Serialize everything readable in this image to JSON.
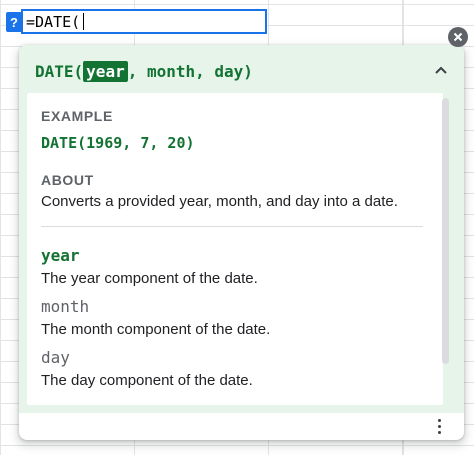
{
  "formula_bar": {
    "help_label": "?",
    "input_text": "=DATE("
  },
  "tooltip": {
    "signature": {
      "function_name": "DATE(",
      "active_arg": "year",
      "rest": ", month, day)"
    },
    "example": {
      "label": "EXAMPLE",
      "code": "DATE(1969, 7, 20)"
    },
    "about": {
      "label": "ABOUT",
      "text": "Converts a provided year, month, and day into a date."
    },
    "arguments": [
      {
        "name": "year",
        "description": "The year component of the date."
      },
      {
        "name": "month",
        "description": "The month component of the date."
      },
      {
        "name": "day",
        "description": "The day component of the date."
      }
    ]
  },
  "icons": {
    "close": "close-icon",
    "collapse": "chevron-up-icon",
    "more": "more-vert-icon"
  },
  "colors": {
    "accent": "#1a73e8",
    "formula_green": "#137333",
    "panel_tint": "#e6f4ea"
  }
}
